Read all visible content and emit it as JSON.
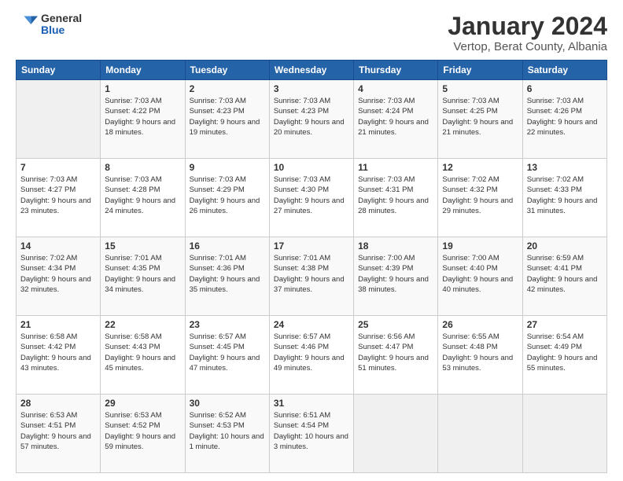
{
  "logo": {
    "general": "General",
    "blue": "Blue"
  },
  "header": {
    "title": "January 2024",
    "subtitle": "Vertop, Berat County, Albania"
  },
  "weekdays": [
    "Sunday",
    "Monday",
    "Tuesday",
    "Wednesday",
    "Thursday",
    "Friday",
    "Saturday"
  ],
  "weeks": [
    [
      {
        "day": "",
        "sunrise": "",
        "sunset": "",
        "daylight": ""
      },
      {
        "day": "1",
        "sunrise": "Sunrise: 7:03 AM",
        "sunset": "Sunset: 4:22 PM",
        "daylight": "Daylight: 9 hours and 18 minutes."
      },
      {
        "day": "2",
        "sunrise": "Sunrise: 7:03 AM",
        "sunset": "Sunset: 4:23 PM",
        "daylight": "Daylight: 9 hours and 19 minutes."
      },
      {
        "day": "3",
        "sunrise": "Sunrise: 7:03 AM",
        "sunset": "Sunset: 4:23 PM",
        "daylight": "Daylight: 9 hours and 20 minutes."
      },
      {
        "day": "4",
        "sunrise": "Sunrise: 7:03 AM",
        "sunset": "Sunset: 4:24 PM",
        "daylight": "Daylight: 9 hours and 21 minutes."
      },
      {
        "day": "5",
        "sunrise": "Sunrise: 7:03 AM",
        "sunset": "Sunset: 4:25 PM",
        "daylight": "Daylight: 9 hours and 21 minutes."
      },
      {
        "day": "6",
        "sunrise": "Sunrise: 7:03 AM",
        "sunset": "Sunset: 4:26 PM",
        "daylight": "Daylight: 9 hours and 22 minutes."
      }
    ],
    [
      {
        "day": "7",
        "sunrise": "Sunrise: 7:03 AM",
        "sunset": "Sunset: 4:27 PM",
        "daylight": "Daylight: 9 hours and 23 minutes."
      },
      {
        "day": "8",
        "sunrise": "Sunrise: 7:03 AM",
        "sunset": "Sunset: 4:28 PM",
        "daylight": "Daylight: 9 hours and 24 minutes."
      },
      {
        "day": "9",
        "sunrise": "Sunrise: 7:03 AM",
        "sunset": "Sunset: 4:29 PM",
        "daylight": "Daylight: 9 hours and 26 minutes."
      },
      {
        "day": "10",
        "sunrise": "Sunrise: 7:03 AM",
        "sunset": "Sunset: 4:30 PM",
        "daylight": "Daylight: 9 hours and 27 minutes."
      },
      {
        "day": "11",
        "sunrise": "Sunrise: 7:03 AM",
        "sunset": "Sunset: 4:31 PM",
        "daylight": "Daylight: 9 hours and 28 minutes."
      },
      {
        "day": "12",
        "sunrise": "Sunrise: 7:02 AM",
        "sunset": "Sunset: 4:32 PM",
        "daylight": "Daylight: 9 hours and 29 minutes."
      },
      {
        "day": "13",
        "sunrise": "Sunrise: 7:02 AM",
        "sunset": "Sunset: 4:33 PM",
        "daylight": "Daylight: 9 hours and 31 minutes."
      }
    ],
    [
      {
        "day": "14",
        "sunrise": "Sunrise: 7:02 AM",
        "sunset": "Sunset: 4:34 PM",
        "daylight": "Daylight: 9 hours and 32 minutes."
      },
      {
        "day": "15",
        "sunrise": "Sunrise: 7:01 AM",
        "sunset": "Sunset: 4:35 PM",
        "daylight": "Daylight: 9 hours and 34 minutes."
      },
      {
        "day": "16",
        "sunrise": "Sunrise: 7:01 AM",
        "sunset": "Sunset: 4:36 PM",
        "daylight": "Daylight: 9 hours and 35 minutes."
      },
      {
        "day": "17",
        "sunrise": "Sunrise: 7:01 AM",
        "sunset": "Sunset: 4:38 PM",
        "daylight": "Daylight: 9 hours and 37 minutes."
      },
      {
        "day": "18",
        "sunrise": "Sunrise: 7:00 AM",
        "sunset": "Sunset: 4:39 PM",
        "daylight": "Daylight: 9 hours and 38 minutes."
      },
      {
        "day": "19",
        "sunrise": "Sunrise: 7:00 AM",
        "sunset": "Sunset: 4:40 PM",
        "daylight": "Daylight: 9 hours and 40 minutes."
      },
      {
        "day": "20",
        "sunrise": "Sunrise: 6:59 AM",
        "sunset": "Sunset: 4:41 PM",
        "daylight": "Daylight: 9 hours and 42 minutes."
      }
    ],
    [
      {
        "day": "21",
        "sunrise": "Sunrise: 6:58 AM",
        "sunset": "Sunset: 4:42 PM",
        "daylight": "Daylight: 9 hours and 43 minutes."
      },
      {
        "day": "22",
        "sunrise": "Sunrise: 6:58 AM",
        "sunset": "Sunset: 4:43 PM",
        "daylight": "Daylight: 9 hours and 45 minutes."
      },
      {
        "day": "23",
        "sunrise": "Sunrise: 6:57 AM",
        "sunset": "Sunset: 4:45 PM",
        "daylight": "Daylight: 9 hours and 47 minutes."
      },
      {
        "day": "24",
        "sunrise": "Sunrise: 6:57 AM",
        "sunset": "Sunset: 4:46 PM",
        "daylight": "Daylight: 9 hours and 49 minutes."
      },
      {
        "day": "25",
        "sunrise": "Sunrise: 6:56 AM",
        "sunset": "Sunset: 4:47 PM",
        "daylight": "Daylight: 9 hours and 51 minutes."
      },
      {
        "day": "26",
        "sunrise": "Sunrise: 6:55 AM",
        "sunset": "Sunset: 4:48 PM",
        "daylight": "Daylight: 9 hours and 53 minutes."
      },
      {
        "day": "27",
        "sunrise": "Sunrise: 6:54 AM",
        "sunset": "Sunset: 4:49 PM",
        "daylight": "Daylight: 9 hours and 55 minutes."
      }
    ],
    [
      {
        "day": "28",
        "sunrise": "Sunrise: 6:53 AM",
        "sunset": "Sunset: 4:51 PM",
        "daylight": "Daylight: 9 hours and 57 minutes."
      },
      {
        "day": "29",
        "sunrise": "Sunrise: 6:53 AM",
        "sunset": "Sunset: 4:52 PM",
        "daylight": "Daylight: 9 hours and 59 minutes."
      },
      {
        "day": "30",
        "sunrise": "Sunrise: 6:52 AM",
        "sunset": "Sunset: 4:53 PM",
        "daylight": "Daylight: 10 hours and 1 minute."
      },
      {
        "day": "31",
        "sunrise": "Sunrise: 6:51 AM",
        "sunset": "Sunset: 4:54 PM",
        "daylight": "Daylight: 10 hours and 3 minutes."
      },
      {
        "day": "",
        "sunrise": "",
        "sunset": "",
        "daylight": ""
      },
      {
        "day": "",
        "sunrise": "",
        "sunset": "",
        "daylight": ""
      },
      {
        "day": "",
        "sunrise": "",
        "sunset": "",
        "daylight": ""
      }
    ]
  ]
}
